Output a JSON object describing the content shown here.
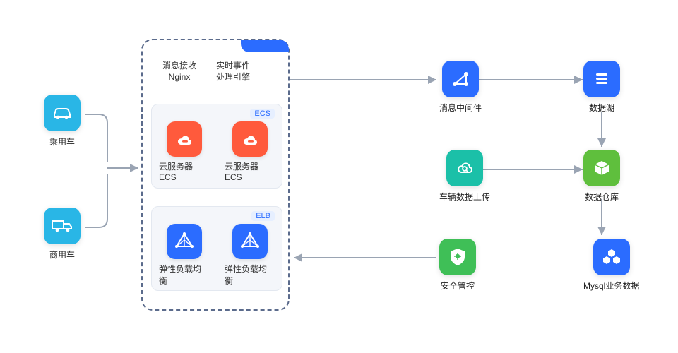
{
  "left_sources": {
    "car": {
      "label": "乘用车"
    },
    "truck": {
      "label": "商用车"
    }
  },
  "panel": {
    "header": {
      "col1_line1": "消息接收",
      "col1_line2": "Nginx",
      "col2_line1": "实时事件",
      "col2_line2": "处理引擎"
    },
    "ecs": {
      "tag": "ECS",
      "item1": "云服务器ECS",
      "item2": "云服务器ECS"
    },
    "elb": {
      "tag": "ELB",
      "item1": "弹性负载均衡",
      "item2": "弹性负载均衡"
    }
  },
  "right_nodes": {
    "topA": {
      "label": "消息中间件"
    },
    "topB": {
      "label": "数据湖"
    },
    "midA": {
      "label": "车辆数据上传"
    },
    "midB": {
      "label": "数据仓库"
    },
    "botA": {
      "label": "安全管控"
    },
    "botB": {
      "label": "Mysql业务数据"
    }
  }
}
